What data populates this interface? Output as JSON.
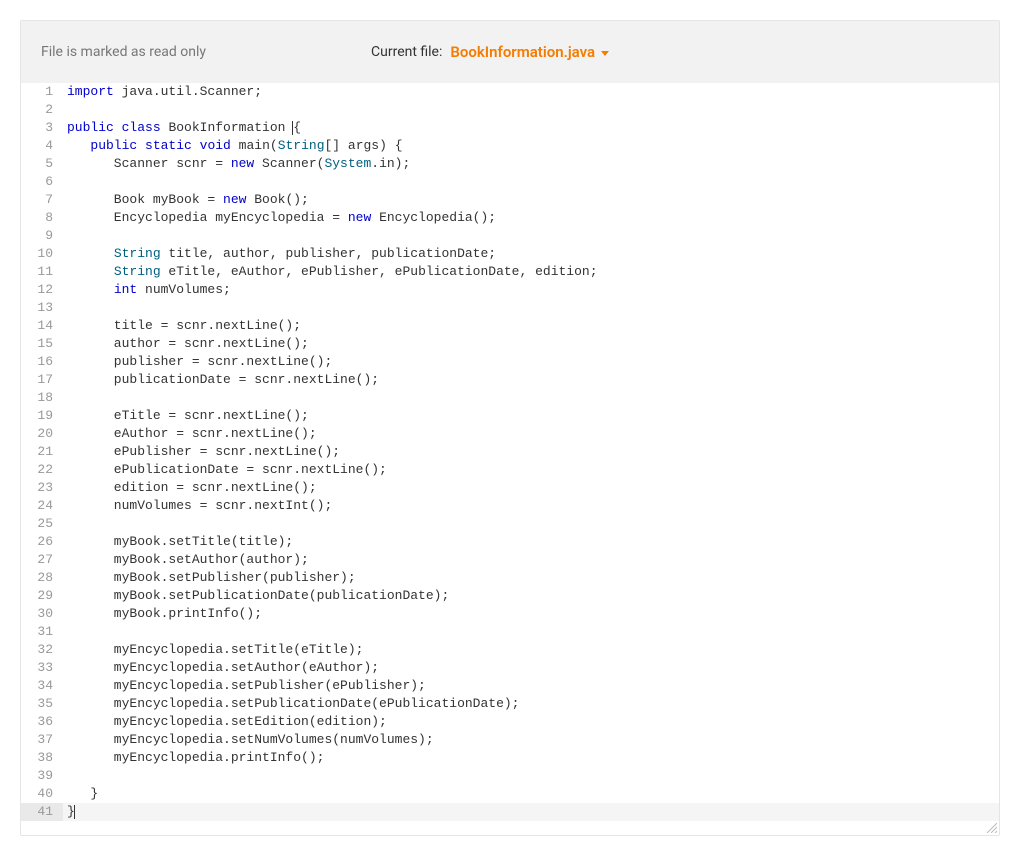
{
  "header": {
    "readonly_text": "File is marked as read only",
    "currentfile_label": "Current file:",
    "currentfile_name": "BookInformation.java"
  },
  "code": {
    "line_count": 41,
    "lines": [
      {
        "n": 1,
        "tokens": [
          {
            "t": "import",
            "c": "kw"
          },
          {
            "t": " java.util.Scanner;",
            "c": ""
          }
        ]
      },
      {
        "n": 2,
        "tokens": []
      },
      {
        "n": 3,
        "tokens": [
          {
            "t": "public",
            "c": "kw"
          },
          {
            "t": " ",
            "c": ""
          },
          {
            "t": "class",
            "c": "kw"
          },
          {
            "t": " BookInformation ",
            "c": ""
          },
          {
            "t": "{",
            "c": "",
            "cursor_before": true
          }
        ]
      },
      {
        "n": 4,
        "tokens": [
          {
            "t": "   ",
            "c": ""
          },
          {
            "t": "public",
            "c": "kw"
          },
          {
            "t": " ",
            "c": ""
          },
          {
            "t": "static",
            "c": "kw"
          },
          {
            "t": " ",
            "c": ""
          },
          {
            "t": "void",
            "c": "kw"
          },
          {
            "t": " main(",
            "c": ""
          },
          {
            "t": "String",
            "c": "cls"
          },
          {
            "t": "[] args) {",
            "c": ""
          }
        ]
      },
      {
        "n": 5,
        "tokens": [
          {
            "t": "      Scanner scnr = ",
            "c": ""
          },
          {
            "t": "new",
            "c": "kw"
          },
          {
            "t": " Scanner(",
            "c": ""
          },
          {
            "t": "System",
            "c": "cls"
          },
          {
            "t": ".in);",
            "c": ""
          }
        ]
      },
      {
        "n": 6,
        "tokens": []
      },
      {
        "n": 7,
        "tokens": [
          {
            "t": "      Book myBook = ",
            "c": ""
          },
          {
            "t": "new",
            "c": "kw"
          },
          {
            "t": " Book();",
            "c": ""
          }
        ]
      },
      {
        "n": 8,
        "tokens": [
          {
            "t": "      Encyclopedia myEncyclopedia = ",
            "c": ""
          },
          {
            "t": "new",
            "c": "kw"
          },
          {
            "t": " Encyclopedia();",
            "c": ""
          }
        ]
      },
      {
        "n": 9,
        "tokens": []
      },
      {
        "n": 10,
        "tokens": [
          {
            "t": "      ",
            "c": ""
          },
          {
            "t": "String",
            "c": "cls"
          },
          {
            "t": " title, author, publisher, publicationDate;",
            "c": ""
          }
        ]
      },
      {
        "n": 11,
        "tokens": [
          {
            "t": "      ",
            "c": ""
          },
          {
            "t": "String",
            "c": "cls"
          },
          {
            "t": " eTitle, eAuthor, ePublisher, ePublicationDate, edition;",
            "c": ""
          }
        ]
      },
      {
        "n": 12,
        "tokens": [
          {
            "t": "      ",
            "c": ""
          },
          {
            "t": "int",
            "c": "kw"
          },
          {
            "t": " numVolumes;",
            "c": ""
          }
        ]
      },
      {
        "n": 13,
        "tokens": []
      },
      {
        "n": 14,
        "tokens": [
          {
            "t": "      title = scnr.nextLine();",
            "c": ""
          }
        ]
      },
      {
        "n": 15,
        "tokens": [
          {
            "t": "      author = scnr.nextLine();",
            "c": ""
          }
        ]
      },
      {
        "n": 16,
        "tokens": [
          {
            "t": "      publisher = scnr.nextLine();",
            "c": ""
          }
        ]
      },
      {
        "n": 17,
        "tokens": [
          {
            "t": "      publicationDate = scnr.nextLine();",
            "c": ""
          }
        ]
      },
      {
        "n": 18,
        "tokens": []
      },
      {
        "n": 19,
        "tokens": [
          {
            "t": "      eTitle = scnr.nextLine();",
            "c": ""
          }
        ]
      },
      {
        "n": 20,
        "tokens": [
          {
            "t": "      eAuthor = scnr.nextLine();",
            "c": ""
          }
        ]
      },
      {
        "n": 21,
        "tokens": [
          {
            "t": "      ePublisher = scnr.nextLine();",
            "c": ""
          }
        ]
      },
      {
        "n": 22,
        "tokens": [
          {
            "t": "      ePublicationDate = scnr.nextLine();",
            "c": ""
          }
        ]
      },
      {
        "n": 23,
        "tokens": [
          {
            "t": "      edition = scnr.nextLine();",
            "c": ""
          }
        ]
      },
      {
        "n": 24,
        "tokens": [
          {
            "t": "      numVolumes = scnr.nextInt();",
            "c": ""
          }
        ]
      },
      {
        "n": 25,
        "tokens": []
      },
      {
        "n": 26,
        "tokens": [
          {
            "t": "      myBook.setTitle(title);",
            "c": ""
          }
        ]
      },
      {
        "n": 27,
        "tokens": [
          {
            "t": "      myBook.setAuthor(author);",
            "c": ""
          }
        ]
      },
      {
        "n": 28,
        "tokens": [
          {
            "t": "      myBook.setPublisher(publisher);",
            "c": ""
          }
        ]
      },
      {
        "n": 29,
        "tokens": [
          {
            "t": "      myBook.setPublicationDate(publicationDate);",
            "c": ""
          }
        ]
      },
      {
        "n": 30,
        "tokens": [
          {
            "t": "      myBook.printInfo();",
            "c": ""
          }
        ]
      },
      {
        "n": 31,
        "tokens": []
      },
      {
        "n": 32,
        "tokens": [
          {
            "t": "      myEncyclopedia.setTitle(eTitle);",
            "c": ""
          }
        ]
      },
      {
        "n": 33,
        "tokens": [
          {
            "t": "      myEncyclopedia.setAuthor(eAuthor);",
            "c": ""
          }
        ]
      },
      {
        "n": 34,
        "tokens": [
          {
            "t": "      myEncyclopedia.setPublisher(ePublisher);",
            "c": ""
          }
        ]
      },
      {
        "n": 35,
        "tokens": [
          {
            "t": "      myEncyclopedia.setPublicationDate(ePublicationDate);",
            "c": ""
          }
        ]
      },
      {
        "n": 36,
        "tokens": [
          {
            "t": "      myEncyclopedia.setEdition(edition);",
            "c": ""
          }
        ]
      },
      {
        "n": 37,
        "tokens": [
          {
            "t": "      myEncyclopedia.setNumVolumes(numVolumes);",
            "c": ""
          }
        ]
      },
      {
        "n": 38,
        "tokens": [
          {
            "t": "      myEncyclopedia.printInfo();",
            "c": ""
          }
        ]
      },
      {
        "n": 39,
        "tokens": []
      },
      {
        "n": 40,
        "tokens": [
          {
            "t": "   }",
            "c": ""
          }
        ]
      },
      {
        "n": 41,
        "tokens": [
          {
            "t": "}",
            "c": ""
          },
          {
            "t": "",
            "c": "",
            "cursor_after": true
          }
        ],
        "highlight": true
      }
    ]
  }
}
